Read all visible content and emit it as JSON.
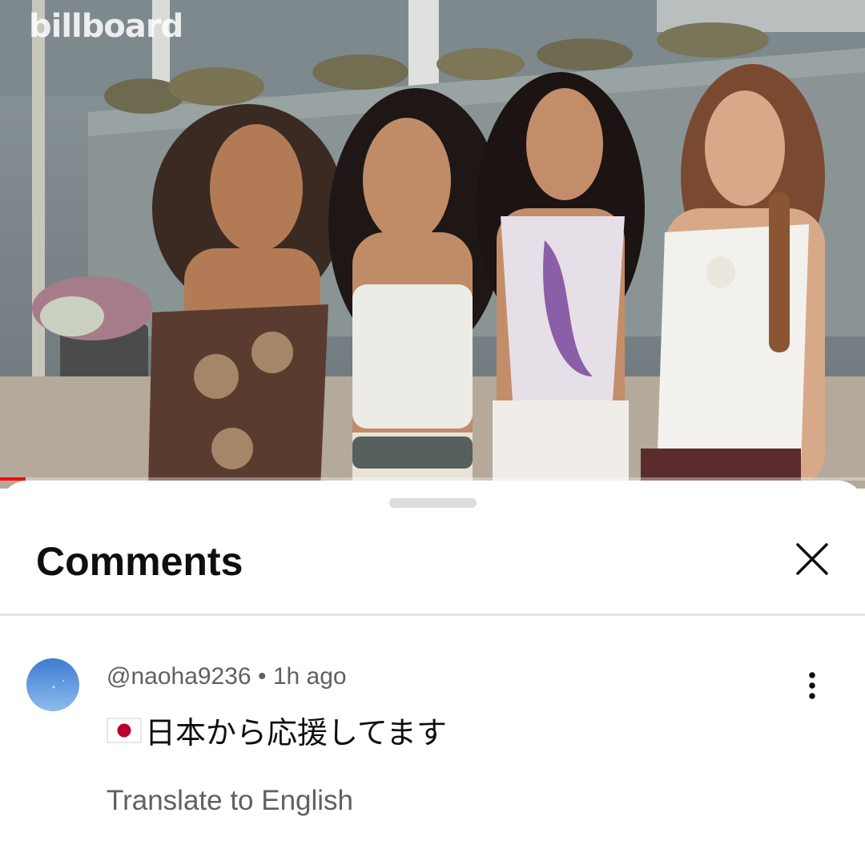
{
  "video": {
    "watermark": "billboard",
    "progress": 0.03,
    "accent_color": "#ff0000"
  },
  "comments_sheet": {
    "title": "Comments",
    "close_icon": "close-icon"
  },
  "comment": {
    "author": "@naoha9236",
    "separator": "•",
    "time": "1h ago",
    "flag_icon": "japan-flag-icon",
    "text": "日本から応援してます",
    "translate_label": "Translate to English",
    "menu_icon": "more-vertical-icon"
  }
}
